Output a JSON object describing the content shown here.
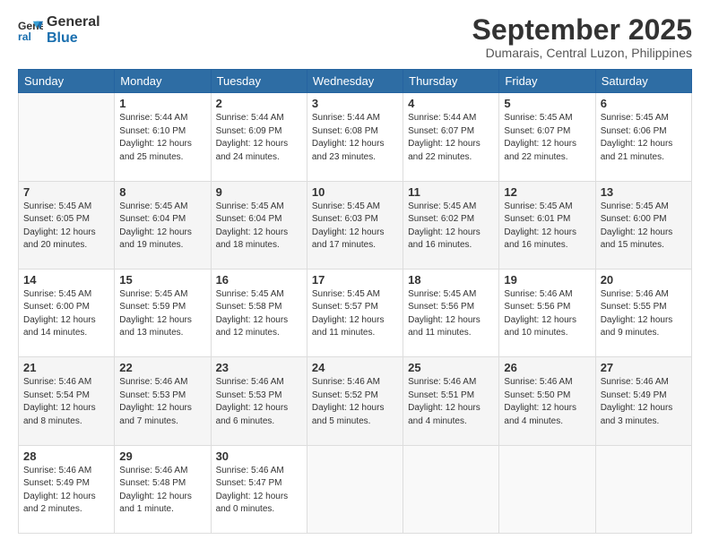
{
  "logo": {
    "line1": "General",
    "line2": "Blue"
  },
  "title": "September 2025",
  "location": "Dumarais, Central Luzon, Philippines",
  "days_header": [
    "Sunday",
    "Monday",
    "Tuesday",
    "Wednesday",
    "Thursday",
    "Friday",
    "Saturday"
  ],
  "weeks": [
    [
      {
        "day": "",
        "info": ""
      },
      {
        "day": "1",
        "info": "Sunrise: 5:44 AM\nSunset: 6:10 PM\nDaylight: 12 hours\nand 25 minutes."
      },
      {
        "day": "2",
        "info": "Sunrise: 5:44 AM\nSunset: 6:09 PM\nDaylight: 12 hours\nand 24 minutes."
      },
      {
        "day": "3",
        "info": "Sunrise: 5:44 AM\nSunset: 6:08 PM\nDaylight: 12 hours\nand 23 minutes."
      },
      {
        "day": "4",
        "info": "Sunrise: 5:44 AM\nSunset: 6:07 PM\nDaylight: 12 hours\nand 22 minutes."
      },
      {
        "day": "5",
        "info": "Sunrise: 5:45 AM\nSunset: 6:07 PM\nDaylight: 12 hours\nand 22 minutes."
      },
      {
        "day": "6",
        "info": "Sunrise: 5:45 AM\nSunset: 6:06 PM\nDaylight: 12 hours\nand 21 minutes."
      }
    ],
    [
      {
        "day": "7",
        "info": "Sunrise: 5:45 AM\nSunset: 6:05 PM\nDaylight: 12 hours\nand 20 minutes."
      },
      {
        "day": "8",
        "info": "Sunrise: 5:45 AM\nSunset: 6:04 PM\nDaylight: 12 hours\nand 19 minutes."
      },
      {
        "day": "9",
        "info": "Sunrise: 5:45 AM\nSunset: 6:04 PM\nDaylight: 12 hours\nand 18 minutes."
      },
      {
        "day": "10",
        "info": "Sunrise: 5:45 AM\nSunset: 6:03 PM\nDaylight: 12 hours\nand 17 minutes."
      },
      {
        "day": "11",
        "info": "Sunrise: 5:45 AM\nSunset: 6:02 PM\nDaylight: 12 hours\nand 16 minutes."
      },
      {
        "day": "12",
        "info": "Sunrise: 5:45 AM\nSunset: 6:01 PM\nDaylight: 12 hours\nand 16 minutes."
      },
      {
        "day": "13",
        "info": "Sunrise: 5:45 AM\nSunset: 6:00 PM\nDaylight: 12 hours\nand 15 minutes."
      }
    ],
    [
      {
        "day": "14",
        "info": "Sunrise: 5:45 AM\nSunset: 6:00 PM\nDaylight: 12 hours\nand 14 minutes."
      },
      {
        "day": "15",
        "info": "Sunrise: 5:45 AM\nSunset: 5:59 PM\nDaylight: 12 hours\nand 13 minutes."
      },
      {
        "day": "16",
        "info": "Sunrise: 5:45 AM\nSunset: 5:58 PM\nDaylight: 12 hours\nand 12 minutes."
      },
      {
        "day": "17",
        "info": "Sunrise: 5:45 AM\nSunset: 5:57 PM\nDaylight: 12 hours\nand 11 minutes."
      },
      {
        "day": "18",
        "info": "Sunrise: 5:45 AM\nSunset: 5:56 PM\nDaylight: 12 hours\nand 11 minutes."
      },
      {
        "day": "19",
        "info": "Sunrise: 5:46 AM\nSunset: 5:56 PM\nDaylight: 12 hours\nand 10 minutes."
      },
      {
        "day": "20",
        "info": "Sunrise: 5:46 AM\nSunset: 5:55 PM\nDaylight: 12 hours\nand 9 minutes."
      }
    ],
    [
      {
        "day": "21",
        "info": "Sunrise: 5:46 AM\nSunset: 5:54 PM\nDaylight: 12 hours\nand 8 minutes."
      },
      {
        "day": "22",
        "info": "Sunrise: 5:46 AM\nSunset: 5:53 PM\nDaylight: 12 hours\nand 7 minutes."
      },
      {
        "day": "23",
        "info": "Sunrise: 5:46 AM\nSunset: 5:53 PM\nDaylight: 12 hours\nand 6 minutes."
      },
      {
        "day": "24",
        "info": "Sunrise: 5:46 AM\nSunset: 5:52 PM\nDaylight: 12 hours\nand 5 minutes."
      },
      {
        "day": "25",
        "info": "Sunrise: 5:46 AM\nSunset: 5:51 PM\nDaylight: 12 hours\nand 4 minutes."
      },
      {
        "day": "26",
        "info": "Sunrise: 5:46 AM\nSunset: 5:50 PM\nDaylight: 12 hours\nand 4 minutes."
      },
      {
        "day": "27",
        "info": "Sunrise: 5:46 AM\nSunset: 5:49 PM\nDaylight: 12 hours\nand 3 minutes."
      }
    ],
    [
      {
        "day": "28",
        "info": "Sunrise: 5:46 AM\nSunset: 5:49 PM\nDaylight: 12 hours\nand 2 minutes."
      },
      {
        "day": "29",
        "info": "Sunrise: 5:46 AM\nSunset: 5:48 PM\nDaylight: 12 hours\nand 1 minute."
      },
      {
        "day": "30",
        "info": "Sunrise: 5:46 AM\nSunset: 5:47 PM\nDaylight: 12 hours\nand 0 minutes."
      },
      {
        "day": "",
        "info": ""
      },
      {
        "day": "",
        "info": ""
      },
      {
        "day": "",
        "info": ""
      },
      {
        "day": "",
        "info": ""
      }
    ]
  ]
}
